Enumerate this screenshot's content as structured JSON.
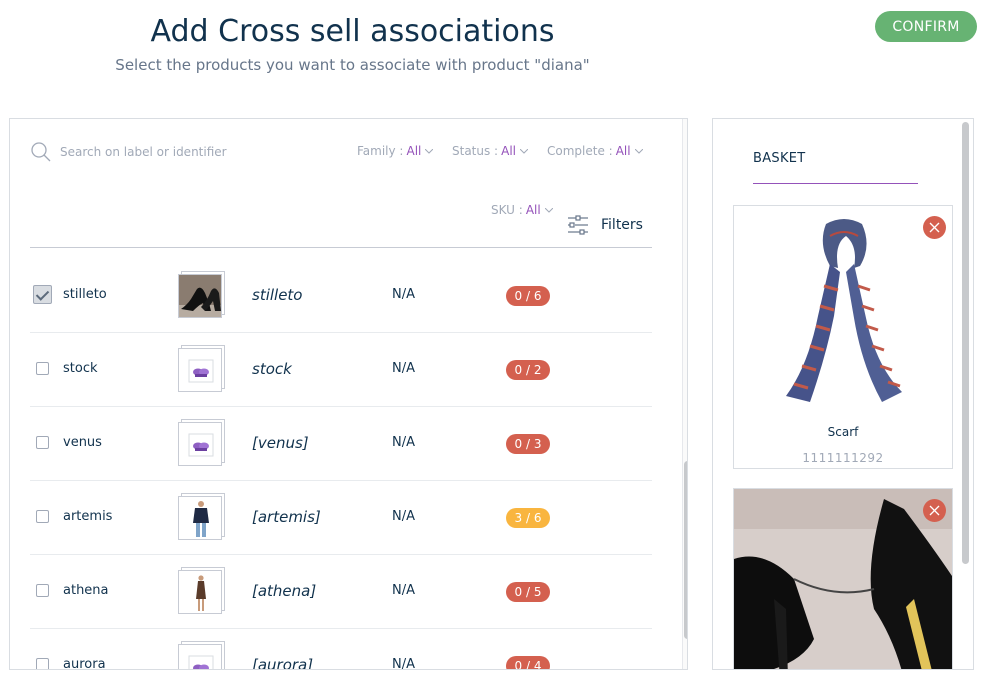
{
  "header": {
    "title": "Add Cross sell associations",
    "subtitle": "Select the products you want to associate with product \"diana\"",
    "confirm_label": "CONFIRM"
  },
  "grid": {
    "search_placeholder": "Search on label or identifier",
    "filters": {
      "family": {
        "label": "Family :",
        "value": "All"
      },
      "status": {
        "label": "Status :",
        "value": "All"
      },
      "complete": {
        "label": "Complete :",
        "value": "All"
      },
      "sku": {
        "label": "SKU :",
        "value": "All"
      }
    },
    "filters_button_label": "Filters",
    "rows": [
      {
        "identifier": "stilleto",
        "label": "stilleto",
        "value": "N/A",
        "completeness": "0 / 6",
        "checked": true,
        "thumb": "shoe"
      },
      {
        "identifier": "stock",
        "label": "stock",
        "value": "N/A",
        "completeness": "0 / 2",
        "checked": false,
        "thumb": "placeholder"
      },
      {
        "identifier": "venus",
        "label": "[venus]",
        "value": "N/A",
        "completeness": "0 / 3",
        "checked": false,
        "thumb": "placeholder"
      },
      {
        "identifier": "artemis",
        "label": "[artemis]",
        "value": "N/A",
        "completeness": "3 / 6",
        "checked": false,
        "thumb": "person-sweater"
      },
      {
        "identifier": "athena",
        "label": "[athena]",
        "value": "N/A",
        "completeness": "0 / 5",
        "checked": false,
        "thumb": "person-dress"
      },
      {
        "identifier": "aurora",
        "label": "[aurora]",
        "value": "N/A",
        "completeness": "0 / 4",
        "checked": false,
        "thumb": "placeholder"
      }
    ]
  },
  "basket": {
    "title": "BASKET",
    "items": [
      {
        "name": "Scarf",
        "identifier": "1111111292",
        "image": "scarf"
      },
      {
        "name": "",
        "identifier": "",
        "image": "black-heels"
      }
    ]
  },
  "colors": {
    "accent": "#9452ba",
    "confirm": "#67b373",
    "danger": "#d4604f",
    "warning": "#f9b53f"
  }
}
